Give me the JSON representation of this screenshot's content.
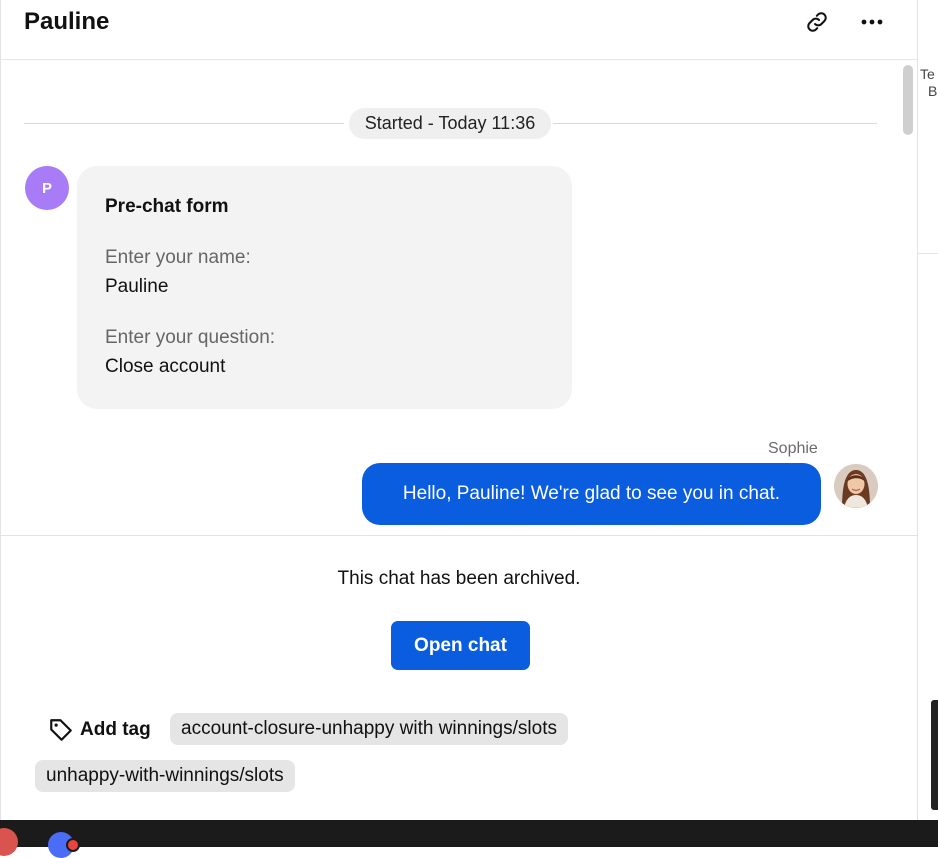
{
  "header": {
    "title": "Pauline",
    "link_icon": "link-icon",
    "more_icon": "more-horizontal-icon"
  },
  "timeline": {
    "started_label": "Started - Today 11:36"
  },
  "customer": {
    "avatar_initial": "P",
    "avatar_color": "#a87cf6"
  },
  "prechat_form": {
    "title": "Pre-chat form",
    "fields": [
      {
        "label": "Enter your name:",
        "value": "Pauline"
      },
      {
        "label": "Enter your question:",
        "value": "Close account"
      }
    ]
  },
  "agent_message": {
    "agent_name": "Sophie",
    "text": "Hello, Pauline! We're glad to see you in chat.",
    "bubble_color": "#0a5ddf"
  },
  "archive": {
    "notice": "This chat has been archived.",
    "open_chat_label": "Open chat"
  },
  "tags": {
    "add_tag_label": "Add tag",
    "tag_icon": "tag-icon",
    "items": [
      "account-closure-unhappy with winnings/slots",
      "unhappy-with-winnings/slots"
    ]
  },
  "right_panel": {
    "partial_text_1": "Te",
    "partial_text_2": "B"
  },
  "colors": {
    "accent": "#0a5ddf",
    "chip_bg": "#e5e5e5",
    "form_bg": "#f3f3f3"
  }
}
